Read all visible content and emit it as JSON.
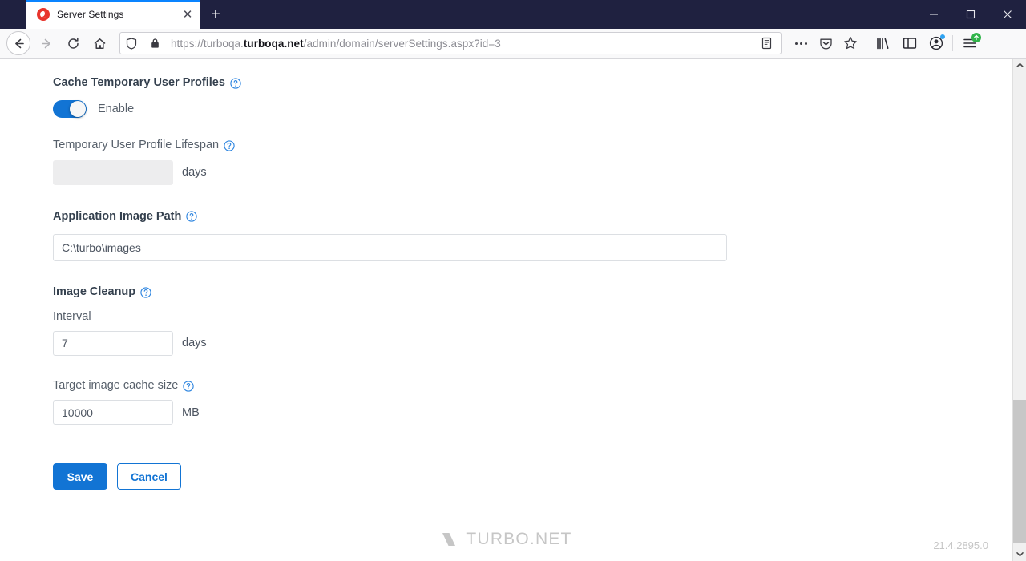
{
  "browser": {
    "window_controls": {
      "minimize": "minimize-button",
      "maximize": "maximize-button",
      "close": "close-button"
    },
    "tab": {
      "title": "Server Settings",
      "favicon": "turbo-logo-icon",
      "close_label": "✕"
    },
    "new_tab_label": "+",
    "nav": {
      "back": "back-icon",
      "forward": "forward-icon",
      "reload": "reload-icon",
      "home": "home-icon"
    },
    "url": {
      "scheme": "https://turboqa.",
      "domain": "turboqa.net",
      "path": "/admin/domain/serverSettings.aspx?id=3",
      "full": "https://turboqa.turboqa.net/admin/domain/serverSettings.aspx?id=3",
      "shield_icon": "tracking-protection-shield-icon",
      "lock_icon": "padlock-icon"
    },
    "url_actions": {
      "reader": "reader-view-icon",
      "page_actions": "page-actions-ellipsis-icon",
      "pocket": "pocket-icon",
      "bookmark": "bookmark-star-icon"
    },
    "toolbar_right": {
      "library": "library-icon",
      "sidebar": "sidebar-icon",
      "account": "account-icon",
      "menu": "hamburger-menu-icon",
      "account_badge": "blue-dot-notification",
      "menu_badge": "green-update-arrow"
    }
  },
  "page": {
    "sections": {
      "cache_profiles": {
        "label": "Cache Temporary User Profiles",
        "help": "help-icon",
        "toggle_state": "on",
        "toggle_label": "Enable"
      },
      "profile_lifespan": {
        "label": "Temporary User Profile Lifespan",
        "help": "help-icon",
        "value": "",
        "unit": "days",
        "disabled": true
      },
      "image_path": {
        "label": "Application Image Path",
        "help": "help-icon",
        "value": "C:\\turbo\\images"
      },
      "image_cleanup": {
        "label": "Image Cleanup",
        "help": "help-icon",
        "interval_label": "Interval",
        "interval_value": "7",
        "interval_unit": "days",
        "cache_size_label": "Target image cache size",
        "cache_size_value": "10000",
        "cache_size_unit": "MB"
      }
    },
    "buttons": {
      "save": "Save",
      "cancel": "Cancel"
    },
    "footer": {
      "brand": "TURBO.NET",
      "version": "21.4.2895.0"
    }
  },
  "colors": {
    "accent_blue": "#1274d4",
    "chrome_dark": "#1f2140",
    "tab_accent": "#0a84ff",
    "label_strong": "#34404e",
    "label_normal": "#57606b",
    "footer_grey": "#c6c6c6"
  }
}
